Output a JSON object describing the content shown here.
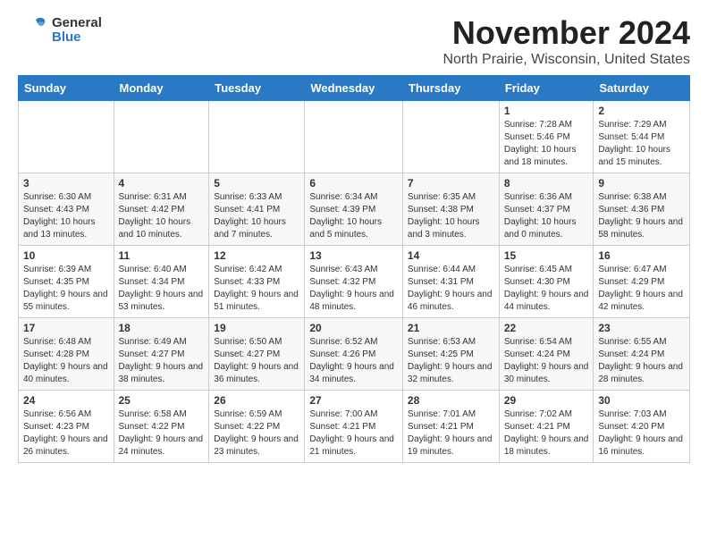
{
  "header": {
    "logo_line1": "General",
    "logo_line2": "Blue",
    "main_title": "November 2024",
    "subtitle": "North Prairie, Wisconsin, United States"
  },
  "calendar": {
    "days_of_week": [
      "Sunday",
      "Monday",
      "Tuesday",
      "Wednesday",
      "Thursday",
      "Friday",
      "Saturday"
    ],
    "weeks": [
      [
        {
          "day": "",
          "detail": ""
        },
        {
          "day": "",
          "detail": ""
        },
        {
          "day": "",
          "detail": ""
        },
        {
          "day": "",
          "detail": ""
        },
        {
          "day": "",
          "detail": ""
        },
        {
          "day": "1",
          "detail": "Sunrise: 7:28 AM\nSunset: 5:46 PM\nDaylight: 10 hours and 18 minutes."
        },
        {
          "day": "2",
          "detail": "Sunrise: 7:29 AM\nSunset: 5:44 PM\nDaylight: 10 hours and 15 minutes."
        }
      ],
      [
        {
          "day": "3",
          "detail": "Sunrise: 6:30 AM\nSunset: 4:43 PM\nDaylight: 10 hours and 13 minutes."
        },
        {
          "day": "4",
          "detail": "Sunrise: 6:31 AM\nSunset: 4:42 PM\nDaylight: 10 hours and 10 minutes."
        },
        {
          "day": "5",
          "detail": "Sunrise: 6:33 AM\nSunset: 4:41 PM\nDaylight: 10 hours and 7 minutes."
        },
        {
          "day": "6",
          "detail": "Sunrise: 6:34 AM\nSunset: 4:39 PM\nDaylight: 10 hours and 5 minutes."
        },
        {
          "day": "7",
          "detail": "Sunrise: 6:35 AM\nSunset: 4:38 PM\nDaylight: 10 hours and 3 minutes."
        },
        {
          "day": "8",
          "detail": "Sunrise: 6:36 AM\nSunset: 4:37 PM\nDaylight: 10 hours and 0 minutes."
        },
        {
          "day": "9",
          "detail": "Sunrise: 6:38 AM\nSunset: 4:36 PM\nDaylight: 9 hours and 58 minutes."
        }
      ],
      [
        {
          "day": "10",
          "detail": "Sunrise: 6:39 AM\nSunset: 4:35 PM\nDaylight: 9 hours and 55 minutes."
        },
        {
          "day": "11",
          "detail": "Sunrise: 6:40 AM\nSunset: 4:34 PM\nDaylight: 9 hours and 53 minutes."
        },
        {
          "day": "12",
          "detail": "Sunrise: 6:42 AM\nSunset: 4:33 PM\nDaylight: 9 hours and 51 minutes."
        },
        {
          "day": "13",
          "detail": "Sunrise: 6:43 AM\nSunset: 4:32 PM\nDaylight: 9 hours and 48 minutes."
        },
        {
          "day": "14",
          "detail": "Sunrise: 6:44 AM\nSunset: 4:31 PM\nDaylight: 9 hours and 46 minutes."
        },
        {
          "day": "15",
          "detail": "Sunrise: 6:45 AM\nSunset: 4:30 PM\nDaylight: 9 hours and 44 minutes."
        },
        {
          "day": "16",
          "detail": "Sunrise: 6:47 AM\nSunset: 4:29 PM\nDaylight: 9 hours and 42 minutes."
        }
      ],
      [
        {
          "day": "17",
          "detail": "Sunrise: 6:48 AM\nSunset: 4:28 PM\nDaylight: 9 hours and 40 minutes."
        },
        {
          "day": "18",
          "detail": "Sunrise: 6:49 AM\nSunset: 4:27 PM\nDaylight: 9 hours and 38 minutes."
        },
        {
          "day": "19",
          "detail": "Sunrise: 6:50 AM\nSunset: 4:27 PM\nDaylight: 9 hours and 36 minutes."
        },
        {
          "day": "20",
          "detail": "Sunrise: 6:52 AM\nSunset: 4:26 PM\nDaylight: 9 hours and 34 minutes."
        },
        {
          "day": "21",
          "detail": "Sunrise: 6:53 AM\nSunset: 4:25 PM\nDaylight: 9 hours and 32 minutes."
        },
        {
          "day": "22",
          "detail": "Sunrise: 6:54 AM\nSunset: 4:24 PM\nDaylight: 9 hours and 30 minutes."
        },
        {
          "day": "23",
          "detail": "Sunrise: 6:55 AM\nSunset: 4:24 PM\nDaylight: 9 hours and 28 minutes."
        }
      ],
      [
        {
          "day": "24",
          "detail": "Sunrise: 6:56 AM\nSunset: 4:23 PM\nDaylight: 9 hours and 26 minutes."
        },
        {
          "day": "25",
          "detail": "Sunrise: 6:58 AM\nSunset: 4:22 PM\nDaylight: 9 hours and 24 minutes."
        },
        {
          "day": "26",
          "detail": "Sunrise: 6:59 AM\nSunset: 4:22 PM\nDaylight: 9 hours and 23 minutes."
        },
        {
          "day": "27",
          "detail": "Sunrise: 7:00 AM\nSunset: 4:21 PM\nDaylight: 9 hours and 21 minutes."
        },
        {
          "day": "28",
          "detail": "Sunrise: 7:01 AM\nSunset: 4:21 PM\nDaylight: 9 hours and 19 minutes."
        },
        {
          "day": "29",
          "detail": "Sunrise: 7:02 AM\nSunset: 4:21 PM\nDaylight: 9 hours and 18 minutes."
        },
        {
          "day": "30",
          "detail": "Sunrise: 7:03 AM\nSunset: 4:20 PM\nDaylight: 9 hours and 16 minutes."
        }
      ]
    ]
  }
}
